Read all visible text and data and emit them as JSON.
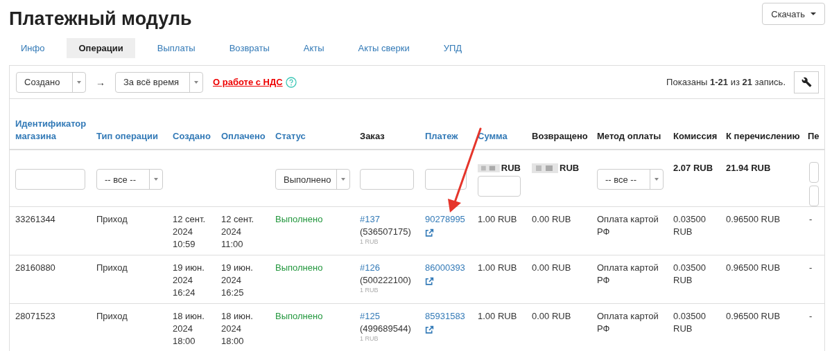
{
  "title": "Платежный модуль",
  "download_button": {
    "label": "Скачать"
  },
  "tabs": [
    {
      "label": "Инфо",
      "selected": false
    },
    {
      "label": "Операции",
      "selected": true
    },
    {
      "label": "Выплаты",
      "selected": false
    },
    {
      "label": "Возвраты",
      "selected": false
    },
    {
      "label": "Акты",
      "selected": false
    },
    {
      "label": "Акты сверки",
      "selected": false
    },
    {
      "label": "УПД",
      "selected": false
    }
  ],
  "toolbar": {
    "date_field": {
      "value": "Создано"
    },
    "arrow": "→",
    "period": {
      "value": "За всё время"
    },
    "vat_link": "О работе с НДС",
    "summary": "Показаны **1-21** из **21** запись."
  },
  "columns": [
    {
      "label": "Идентификатор магазина",
      "sortable": true
    },
    {
      "label": "Тип операции",
      "sortable": true
    },
    {
      "label": "Создано",
      "sortable": true
    },
    {
      "label": "Оплачено",
      "sortable": true
    },
    {
      "label": "Статус",
      "sortable": true
    },
    {
      "label": "Заказ",
      "sortable": false
    },
    {
      "label": "Платеж",
      "sortable": true
    },
    {
      "label": "Сумма",
      "sortable": true
    },
    {
      "label": "Возвращено",
      "sortable": false
    },
    {
      "label": "Метод оплаты",
      "sortable": false
    },
    {
      "label": "Комиссия",
      "sortable": false
    },
    {
      "label": "К перечислению",
      "sortable": false
    },
    {
      "label": "Пе",
      "sortable": false
    }
  ],
  "filters": [
    {
      "kind": "input"
    },
    {
      "kind": "select",
      "value": "-- все --"
    },
    {
      "kind": "empty"
    },
    {
      "kind": "empty"
    },
    {
      "kind": "select",
      "value": "Выполнено"
    },
    {
      "kind": "input"
    },
    {
      "kind": "input"
    },
    {
      "kind": "total",
      "text": "RUB",
      "masked": true,
      "input": true
    },
    {
      "kind": "total",
      "text": "RUB",
      "masked": true,
      "input": false
    },
    {
      "kind": "select",
      "value": "-- все --"
    },
    {
      "kind": "total",
      "text": "2.07 RUB",
      "masked": false,
      "input": false
    },
    {
      "kind": "total",
      "text": "21.94 RUB",
      "masked": false,
      "input": false
    },
    {
      "kind": "inputs"
    }
  ],
  "rows": [
    {
      "shop_id": "33261344",
      "type": "Приход",
      "created": "12 сент. 2024 10:59",
      "paid": "12 сент. 2024 11:00",
      "status": "Выполнено",
      "order": {
        "number": "#137",
        "id": "(536507175)",
        "amount": "1 RUB"
      },
      "payment": "90278995",
      "sum": "1.00 RUB",
      "returned": "0.00 RUB",
      "method": "Оплата картой РФ",
      "commission": "0.03500 RUB",
      "transfer": "0.96500 RUB",
      "column_13": "-"
    },
    {
      "shop_id": "28160880",
      "type": "Приход",
      "created": "19 июн. 2024 16:24",
      "paid": "19 июн. 2024 16:25",
      "status": "Выполнено",
      "order": {
        "number": "#126",
        "id": "(500222100)",
        "amount": "1 RUB"
      },
      "payment": "86000393",
      "sum": "1.00 RUB",
      "returned": "0.00 RUB",
      "method": "Оплата картой РФ",
      "commission": "0.03500 RUB",
      "transfer": "0.96500 RUB",
      "column_13": "-"
    },
    {
      "shop_id": "28071523",
      "type": "Приход",
      "created": "18 июн. 2024 18:00",
      "paid": "18 июн. 2024 18:00",
      "status": "Выполнено",
      "order": {
        "number": "#125",
        "id": "(499689544)",
        "amount": "1 RUB"
      },
      "payment": "85931583",
      "sum": "1.00 RUB",
      "returned": "0.00 RUB",
      "method": "Оплата картой РФ",
      "commission": "0.03500 RUB",
      "transfer": "0.96500 RUB",
      "column_13": "-"
    }
  ]
}
